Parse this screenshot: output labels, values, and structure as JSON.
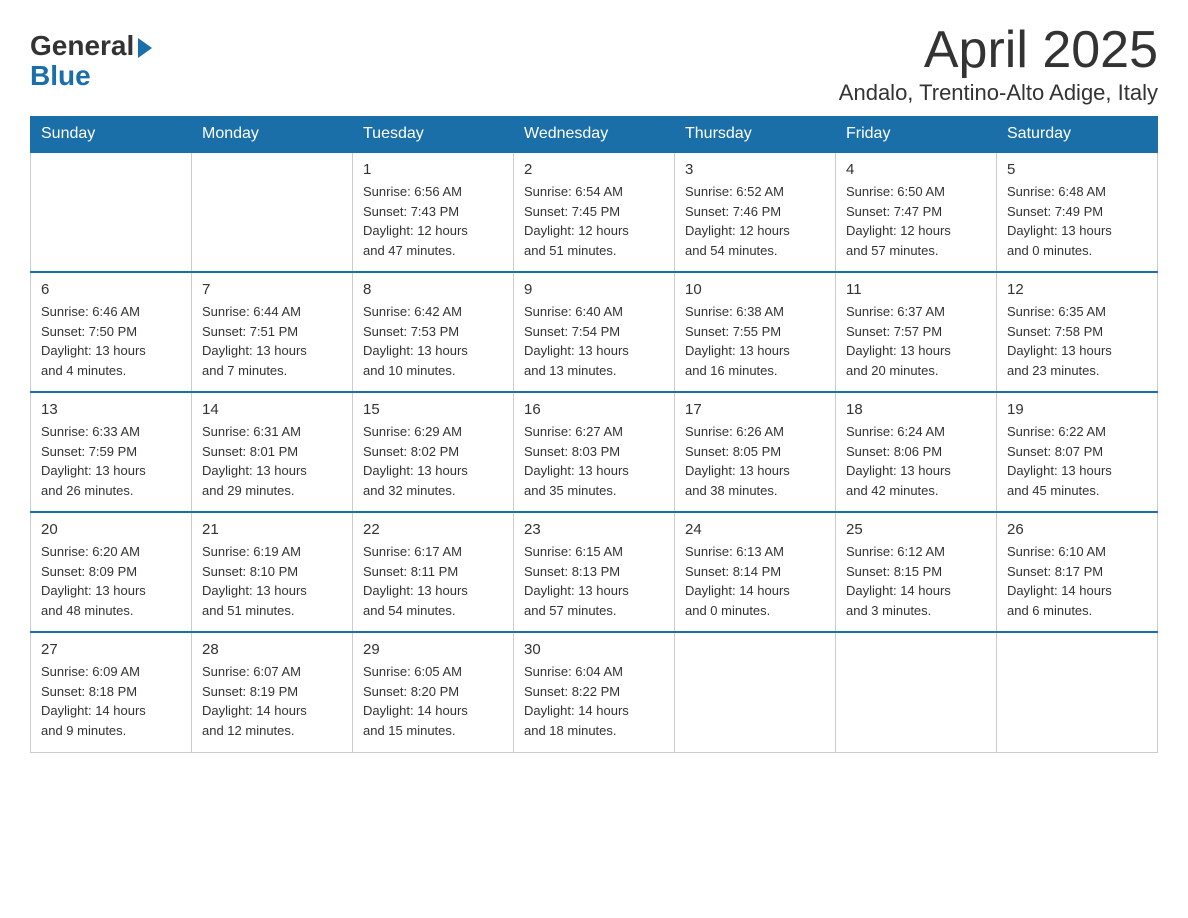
{
  "logo": {
    "general": "General",
    "blue": "Blue"
  },
  "header": {
    "month": "April 2025",
    "location": "Andalo, Trentino-Alto Adige, Italy"
  },
  "days_of_week": [
    "Sunday",
    "Monday",
    "Tuesday",
    "Wednesday",
    "Thursday",
    "Friday",
    "Saturday"
  ],
  "weeks": [
    [
      {
        "day": "",
        "info": ""
      },
      {
        "day": "",
        "info": ""
      },
      {
        "day": "1",
        "info": "Sunrise: 6:56 AM\nSunset: 7:43 PM\nDaylight: 12 hours\nand 47 minutes."
      },
      {
        "day": "2",
        "info": "Sunrise: 6:54 AM\nSunset: 7:45 PM\nDaylight: 12 hours\nand 51 minutes."
      },
      {
        "day": "3",
        "info": "Sunrise: 6:52 AM\nSunset: 7:46 PM\nDaylight: 12 hours\nand 54 minutes."
      },
      {
        "day": "4",
        "info": "Sunrise: 6:50 AM\nSunset: 7:47 PM\nDaylight: 12 hours\nand 57 minutes."
      },
      {
        "day": "5",
        "info": "Sunrise: 6:48 AM\nSunset: 7:49 PM\nDaylight: 13 hours\nand 0 minutes."
      }
    ],
    [
      {
        "day": "6",
        "info": "Sunrise: 6:46 AM\nSunset: 7:50 PM\nDaylight: 13 hours\nand 4 minutes."
      },
      {
        "day": "7",
        "info": "Sunrise: 6:44 AM\nSunset: 7:51 PM\nDaylight: 13 hours\nand 7 minutes."
      },
      {
        "day": "8",
        "info": "Sunrise: 6:42 AM\nSunset: 7:53 PM\nDaylight: 13 hours\nand 10 minutes."
      },
      {
        "day": "9",
        "info": "Sunrise: 6:40 AM\nSunset: 7:54 PM\nDaylight: 13 hours\nand 13 minutes."
      },
      {
        "day": "10",
        "info": "Sunrise: 6:38 AM\nSunset: 7:55 PM\nDaylight: 13 hours\nand 16 minutes."
      },
      {
        "day": "11",
        "info": "Sunrise: 6:37 AM\nSunset: 7:57 PM\nDaylight: 13 hours\nand 20 minutes."
      },
      {
        "day": "12",
        "info": "Sunrise: 6:35 AM\nSunset: 7:58 PM\nDaylight: 13 hours\nand 23 minutes."
      }
    ],
    [
      {
        "day": "13",
        "info": "Sunrise: 6:33 AM\nSunset: 7:59 PM\nDaylight: 13 hours\nand 26 minutes."
      },
      {
        "day": "14",
        "info": "Sunrise: 6:31 AM\nSunset: 8:01 PM\nDaylight: 13 hours\nand 29 minutes."
      },
      {
        "day": "15",
        "info": "Sunrise: 6:29 AM\nSunset: 8:02 PM\nDaylight: 13 hours\nand 32 minutes."
      },
      {
        "day": "16",
        "info": "Sunrise: 6:27 AM\nSunset: 8:03 PM\nDaylight: 13 hours\nand 35 minutes."
      },
      {
        "day": "17",
        "info": "Sunrise: 6:26 AM\nSunset: 8:05 PM\nDaylight: 13 hours\nand 38 minutes."
      },
      {
        "day": "18",
        "info": "Sunrise: 6:24 AM\nSunset: 8:06 PM\nDaylight: 13 hours\nand 42 minutes."
      },
      {
        "day": "19",
        "info": "Sunrise: 6:22 AM\nSunset: 8:07 PM\nDaylight: 13 hours\nand 45 minutes."
      }
    ],
    [
      {
        "day": "20",
        "info": "Sunrise: 6:20 AM\nSunset: 8:09 PM\nDaylight: 13 hours\nand 48 minutes."
      },
      {
        "day": "21",
        "info": "Sunrise: 6:19 AM\nSunset: 8:10 PM\nDaylight: 13 hours\nand 51 minutes."
      },
      {
        "day": "22",
        "info": "Sunrise: 6:17 AM\nSunset: 8:11 PM\nDaylight: 13 hours\nand 54 minutes."
      },
      {
        "day": "23",
        "info": "Sunrise: 6:15 AM\nSunset: 8:13 PM\nDaylight: 13 hours\nand 57 minutes."
      },
      {
        "day": "24",
        "info": "Sunrise: 6:13 AM\nSunset: 8:14 PM\nDaylight: 14 hours\nand 0 minutes."
      },
      {
        "day": "25",
        "info": "Sunrise: 6:12 AM\nSunset: 8:15 PM\nDaylight: 14 hours\nand 3 minutes."
      },
      {
        "day": "26",
        "info": "Sunrise: 6:10 AM\nSunset: 8:17 PM\nDaylight: 14 hours\nand 6 minutes."
      }
    ],
    [
      {
        "day": "27",
        "info": "Sunrise: 6:09 AM\nSunset: 8:18 PM\nDaylight: 14 hours\nand 9 minutes."
      },
      {
        "day": "28",
        "info": "Sunrise: 6:07 AM\nSunset: 8:19 PM\nDaylight: 14 hours\nand 12 minutes."
      },
      {
        "day": "29",
        "info": "Sunrise: 6:05 AM\nSunset: 8:20 PM\nDaylight: 14 hours\nand 15 minutes."
      },
      {
        "day": "30",
        "info": "Sunrise: 6:04 AM\nSunset: 8:22 PM\nDaylight: 14 hours\nand 18 minutes."
      },
      {
        "day": "",
        "info": ""
      },
      {
        "day": "",
        "info": ""
      },
      {
        "day": "",
        "info": ""
      }
    ]
  ]
}
